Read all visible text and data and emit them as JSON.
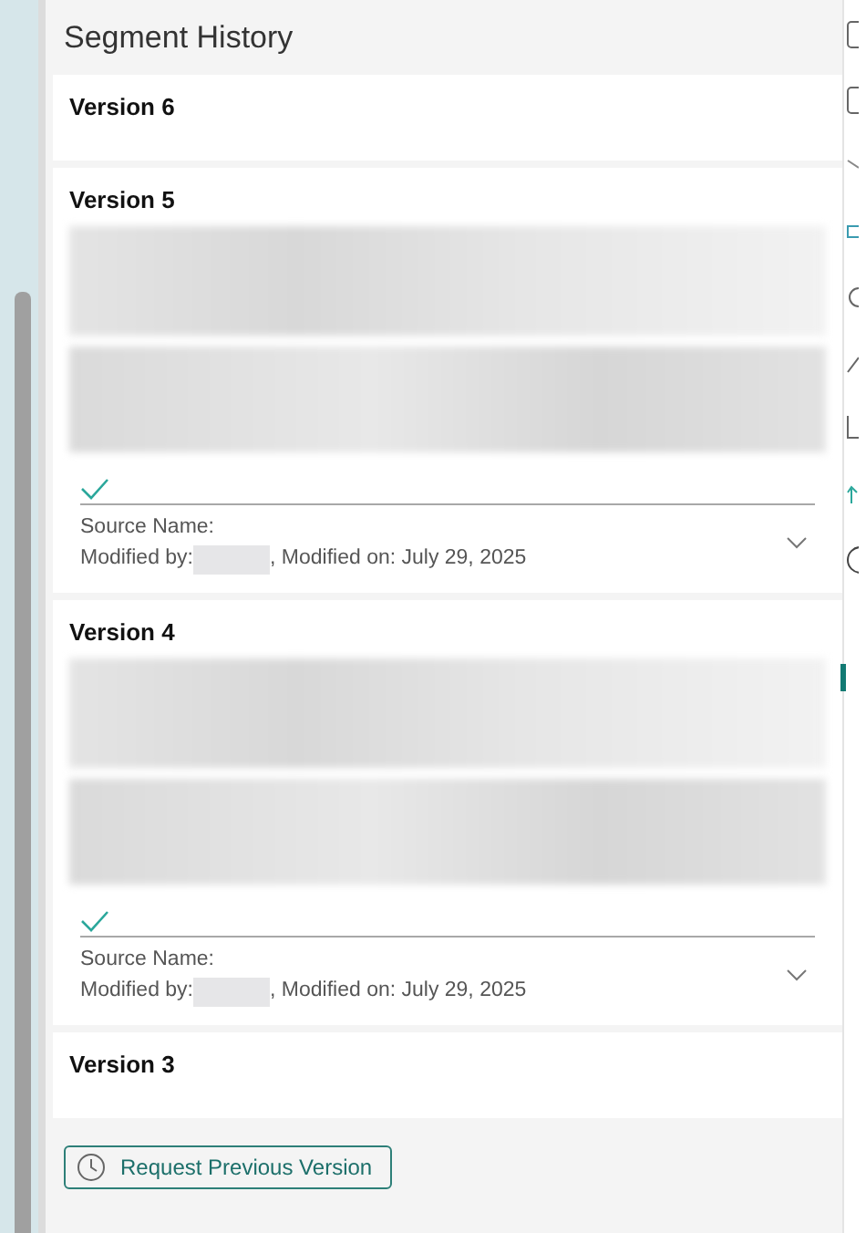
{
  "panel": {
    "title": "Segment History"
  },
  "versions": [
    {
      "title": "Version 6",
      "kind": "collapsed"
    },
    {
      "title": "Version 5",
      "kind": "expanded",
      "source_label": "Source Name:",
      "modified_by_label": "Modified by:",
      "modified_on": ", Modified on: July 29, 2025"
    },
    {
      "title": "Version 4",
      "kind": "expanded",
      "source_label": "Source Name:",
      "modified_by_label": "Modified by:",
      "modified_on": ", Modified on: July 29, 2025"
    },
    {
      "title": "Version 3",
      "kind": "collapsed"
    }
  ],
  "action_button": {
    "label": "Request Previous Version"
  }
}
